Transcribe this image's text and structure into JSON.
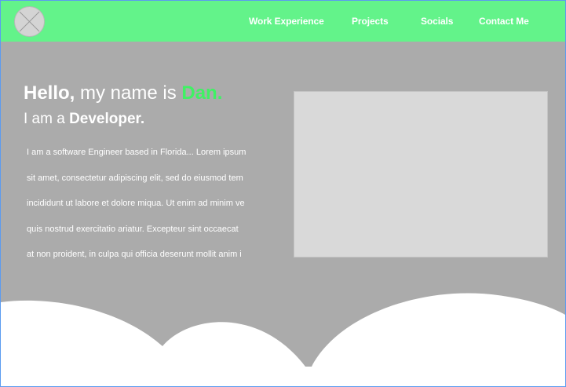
{
  "nav": {
    "logo_icon": "placeholder-image-icon",
    "links": [
      "Work Experience",
      "Projects",
      "Socials",
      "Contact Me"
    ]
  },
  "hero": {
    "greeting": "Hello,",
    "intro": " my name is ",
    "name": "Dan.",
    "role_prefix": "I am a ",
    "role": "Developer."
  },
  "bio": {
    "lines": [
      "I am a software Engineer based in Florida... Lorem ipsum",
      "sit amet, consectetur adipiscing elit, sed do eiusmod tem",
      "incididunt ut labore et dolore miqua. Ut enim ad minim ve",
      "quis nostrud exercitatio ariatur. Excepteur sint occaecat",
      "at non proident, in culpa qui officia deserunt mollit anim i"
    ]
  },
  "colors": {
    "navbar": "#63f38a",
    "accent": "#3ff263",
    "background": "#ababab",
    "placeholder": "#d9d9d9"
  }
}
